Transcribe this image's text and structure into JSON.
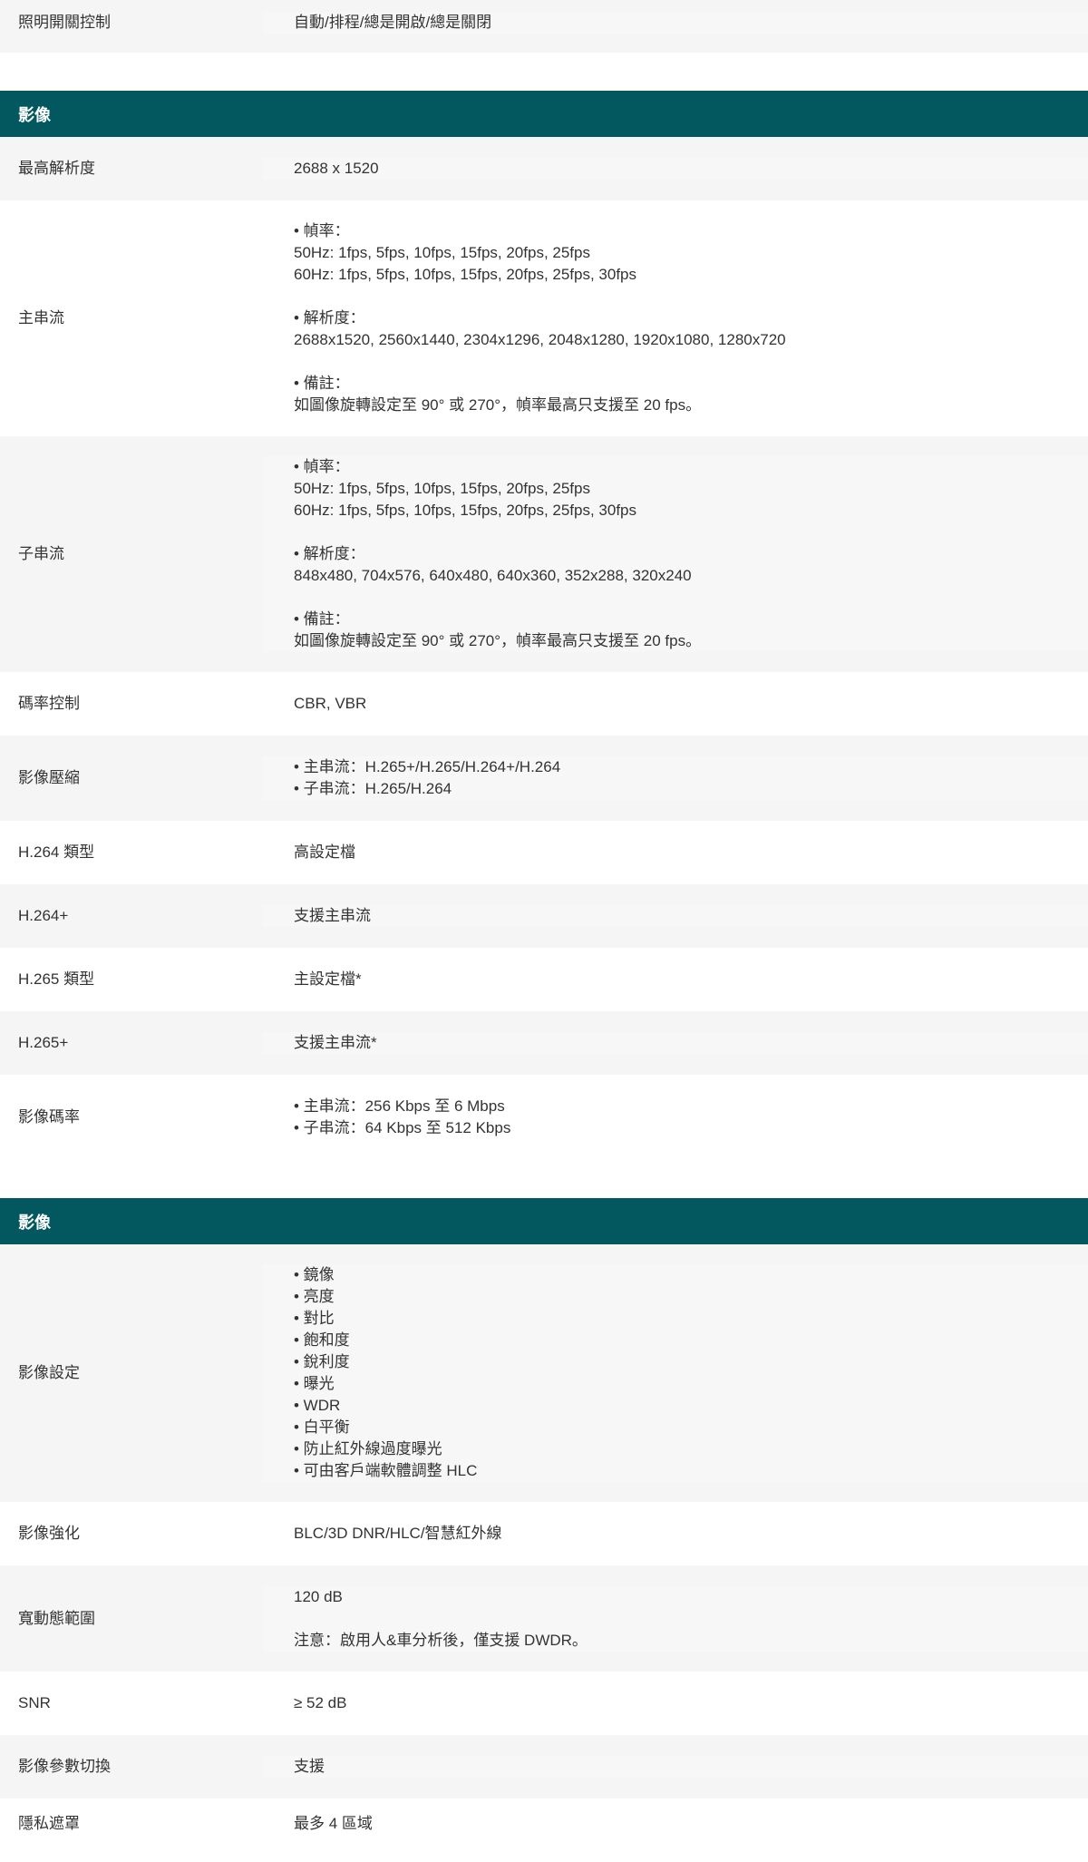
{
  "top_rows": [
    {
      "label": "照明開關控制",
      "lines": [
        "自動/排程/總是開啟/總是關閉"
      ]
    }
  ],
  "section1": {
    "title": "影像",
    "rows": [
      {
        "label": "最高解析度",
        "lines": [
          "2688 x 1520"
        ]
      },
      {
        "label": "主串流",
        "lines": [
          "• 幀率：",
          "50Hz: 1fps, 5fps, 10fps, 15fps, 20fps, 25fps",
          "60Hz: 1fps, 5fps, 10fps, 15fps, 20fps, 25fps, 30fps",
          "",
          "• 解析度：",
          "2688x1520, 2560x1440, 2304x1296, 2048x1280, 1920x1080, 1280x720",
          "",
          "• 備註：",
          "如圖像旋轉設定至 90° 或 270°，幀率最高只支援至 20 fps。"
        ]
      },
      {
        "label": "子串流",
        "lines": [
          "• 幀率：",
          "50Hz: 1fps, 5fps, 10fps, 15fps, 20fps, 25fps",
          "60Hz: 1fps, 5fps, 10fps, 15fps, 20fps, 25fps, 30fps",
          "",
          "• 解析度：",
          "848x480, 704x576, 640x480, 640x360, 352x288, 320x240",
          "",
          "• 備註：",
          "如圖像旋轉設定至 90° 或 270°，幀率最高只支援至 20 fps。"
        ]
      },
      {
        "label": "碼率控制",
        "lines": [
          "CBR, VBR"
        ]
      },
      {
        "label": "影像壓縮",
        "lines": [
          "• 主串流：H.265+/H.265/H.264+/H.264",
          "• 子串流：H.265/H.264"
        ]
      },
      {
        "label": "H.264 類型",
        "lines": [
          "高設定檔"
        ]
      },
      {
        "label": "H.264+",
        "lines": [
          "支援主串流"
        ]
      },
      {
        "label": "H.265 類型",
        "lines": [
          "主設定檔*"
        ]
      },
      {
        "label": "H.265+",
        "lines": [
          "支援主串流*"
        ]
      },
      {
        "label": "影像碼率",
        "lines": [
          "• 主串流：256 Kbps 至 6 Mbps",
          "• 子串流：64 Kbps 至 512 Kbps"
        ]
      }
    ]
  },
  "section2": {
    "title": "影像",
    "rows": [
      {
        "label": "影像設定",
        "lines": [
          "• 鏡像",
          "• 亮度",
          "• 對比",
          "• 飽和度",
          "• 銳利度",
          "• 曝光",
          "• WDR",
          "• 白平衡",
          "• 防止紅外線過度曝光",
          "• 可由客戶端軟體調整 HLC"
        ]
      },
      {
        "label": "影像強化",
        "lines": [
          "BLC/3D DNR/HLC/智慧紅外線"
        ]
      },
      {
        "label": "寬動態範圍",
        "lines": [
          "120 dB",
          "",
          "注意：啟用人&車分析後，僅支援 DWDR。"
        ]
      },
      {
        "label": "SNR",
        "lines": [
          "≥ 52 dB"
        ]
      },
      {
        "label": "影像參數切換",
        "lines": [
          "支援"
        ]
      },
      {
        "label": "隱私遮罩",
        "lines": [
          "最多 4 區域"
        ]
      }
    ]
  }
}
